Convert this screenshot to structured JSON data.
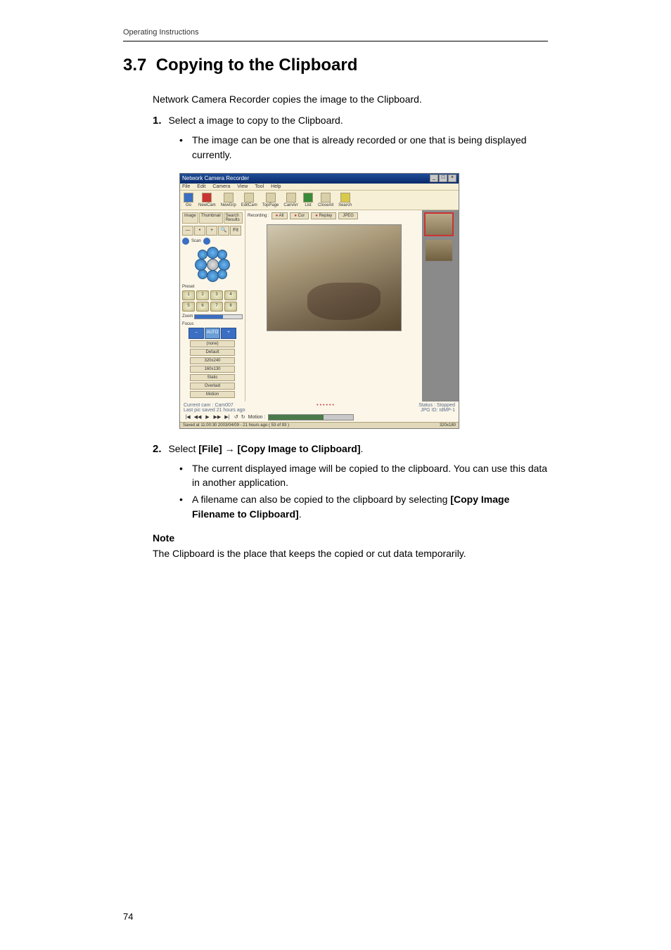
{
  "header": "Operating Instructions",
  "section_number": "3.7",
  "section_title": "Copying to the Clipboard",
  "intro": "Network Camera Recorder copies the image to the Clipboard.",
  "step1_num": "1.",
  "step1_text": "Select a image to copy to the Clipboard.",
  "step1_bullet": "The image can be one that is already recorded or one that is being displayed currently.",
  "screenshot": {
    "title": "Network Camera Recorder",
    "win_min": "_",
    "win_max": "□",
    "win_close": "×",
    "menu": {
      "file": "File",
      "edit": "Edit",
      "camera": "Camera",
      "view": "View",
      "tool": "Tool",
      "help": "Help"
    },
    "toolbar": {
      "go": "Go",
      "newcam": "NewCam",
      "newgrp": "NewGrp",
      "editcam": "EditCam",
      "toppage": "TopPage",
      "camarr": "CamArr",
      "list": "List",
      "closeall": "CloseAll",
      "search": "Search"
    },
    "tabs": {
      "image": "Image",
      "thumbnail": "Thumbnail",
      "search": "Search Results"
    },
    "ctrl_minus": "—",
    "ctrl_dot": "•",
    "ctrl_plus": "+",
    "ctrl_mag": "🔍",
    "ctrl_fit": "Fit",
    "scan_label": "Scan",
    "preset_label": "Preset",
    "zoom_label": "Zoom",
    "focus_label": "Focus",
    "focus_minus": "–",
    "focus_auto": "AUTO",
    "focus_plus": "+",
    "preset_sel": "(none)",
    "btn_default": "Default",
    "btn_320": "320x240",
    "btn_160": "160x130",
    "btn_static": "Static",
    "btn_overlaid": "Overlaid",
    "btn_motion": "Motion",
    "rec_label": "Recording :",
    "rec_all": "All",
    "rec_cur": "Cur",
    "rec_replay": "Replay",
    "rec_jpeg": "JPEG",
    "status_cam": "Current cam : Cam007",
    "status_last": "Last  pic saved 21  hours ago",
    "status_right1": "Status : Stopped",
    "status_right2": "JPG  ID: IdMP-1",
    "play_first": "|◀",
    "play_prev": "◀◀",
    "play_play": "▶",
    "play_next": "▶▶",
    "play_last": "▶|",
    "rewind": "↺",
    "forward": "↻",
    "motion_label": "Motion :",
    "bottom_left": "Saved at 11:00:30 2003/04/09 - 21 hours ago ( 53 of 93 )",
    "bottom_right": "320x180"
  },
  "step2_num": "2.",
  "step2_text_pre": "Select ",
  "step2_b1": "[File]",
  "step2_arrow": " → ",
  "step2_b2": "[Copy Image to Clipboard]",
  "step2_dot": ".",
  "step2_bullet1": "The current displayed image will be copied to the clipboard. You can use this data in another application.",
  "step2_bullet2_pre": "A filename can also be copied to the clipboard by selecting ",
  "step2_bullet2_b": "[Copy Image Filename to Clipboard]",
  "step2_bullet2_post": ".",
  "note_label": "Note",
  "note_text": "The Clipboard is the place that keeps the copied or cut data temporarily.",
  "page_num": "74"
}
